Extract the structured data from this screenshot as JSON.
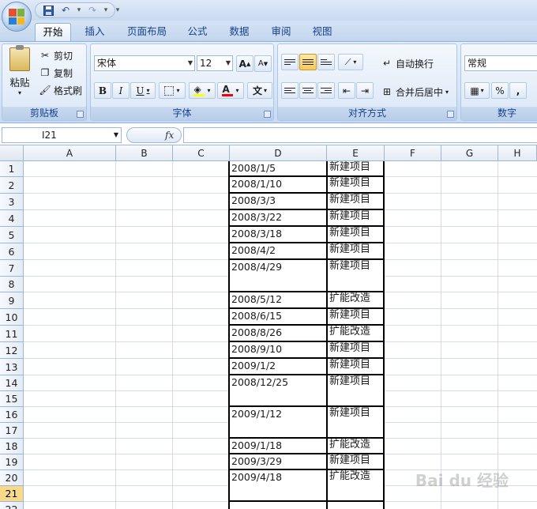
{
  "qat": {
    "save_icon": "save-icon",
    "undo_icon": "undo-icon",
    "redo_icon": "redo-icon"
  },
  "tabs": [
    {
      "label": "开始",
      "active": true
    },
    {
      "label": "插入"
    },
    {
      "label": "页面布局"
    },
    {
      "label": "公式"
    },
    {
      "label": "数据"
    },
    {
      "label": "审阅"
    },
    {
      "label": "视图"
    }
  ],
  "clipboard": {
    "paste": "粘贴",
    "cut": "剪切",
    "copy": "复制",
    "format_painter": "格式刷",
    "title": "剪贴板"
  },
  "font": {
    "name": "宋体",
    "size": "12",
    "title": "字体",
    "bold": "B",
    "italic": "I",
    "underline": "U",
    "font_color_glyph": "A",
    "phonetic_glyph": "文",
    "grow": "A",
    "shrink": "A"
  },
  "alignment": {
    "wrap": "自动换行",
    "merge": "合并后居中",
    "title": "对齐方式"
  },
  "number": {
    "format": "常规",
    "percent": "%",
    "comma": ",",
    "title": "数字"
  },
  "formula_bar": {
    "name_box": "I21",
    "fx": "fx",
    "value": ""
  },
  "columns": [
    "A",
    "B",
    "C",
    "D",
    "E",
    "F",
    "G",
    "H"
  ],
  "rows": [
    "1",
    "2",
    "3",
    "4",
    "5",
    "6",
    "7",
    "8",
    "9",
    "10",
    "11",
    "12",
    "13",
    "14",
    "15",
    "16",
    "17",
    "18",
    "19",
    "20",
    "21",
    "22"
  ],
  "selected_row": "21",
  "records": [
    {
      "date": "2008/1/5",
      "type": "新建项目"
    },
    {
      "date": "2008/1/10",
      "type": "新建项目"
    },
    {
      "date": "2008/3/3",
      "type": "新建项目"
    },
    {
      "date": "2008/3/22",
      "type": "新建项目"
    },
    {
      "date": "2008/3/18",
      "type": "新建项目"
    },
    {
      "date": "2008/4/2",
      "type": "新建项目"
    },
    {
      "date": "2008/4/29",
      "type": "新建项目"
    },
    {
      "date": "2008/5/12",
      "type": "扩能改造"
    },
    {
      "date": "2008/6/15",
      "type": "新建项目"
    },
    {
      "date": "2008/8/26",
      "type": "扩能改造"
    },
    {
      "date": "2008/9/10",
      "type": "新建项目"
    },
    {
      "date": "2009/1/2",
      "type": "新建项目"
    },
    {
      "date": "2008/12/25",
      "type": "新建项目"
    },
    {
      "date": "2009/1/12",
      "type": "新建项目"
    },
    {
      "date": "2009/1/18",
      "type": "扩能改造"
    },
    {
      "date": "2009/3/29",
      "type": "新建项目"
    },
    {
      "date": "2009/4/18",
      "type": "扩能改造"
    }
  ],
  "watermark": "Bai du 经验",
  "colors": {
    "accent": "#15428b",
    "ribbon": "#d7e5f7",
    "selection": "#f9d98a",
    "grid": "#d4dde9"
  }
}
